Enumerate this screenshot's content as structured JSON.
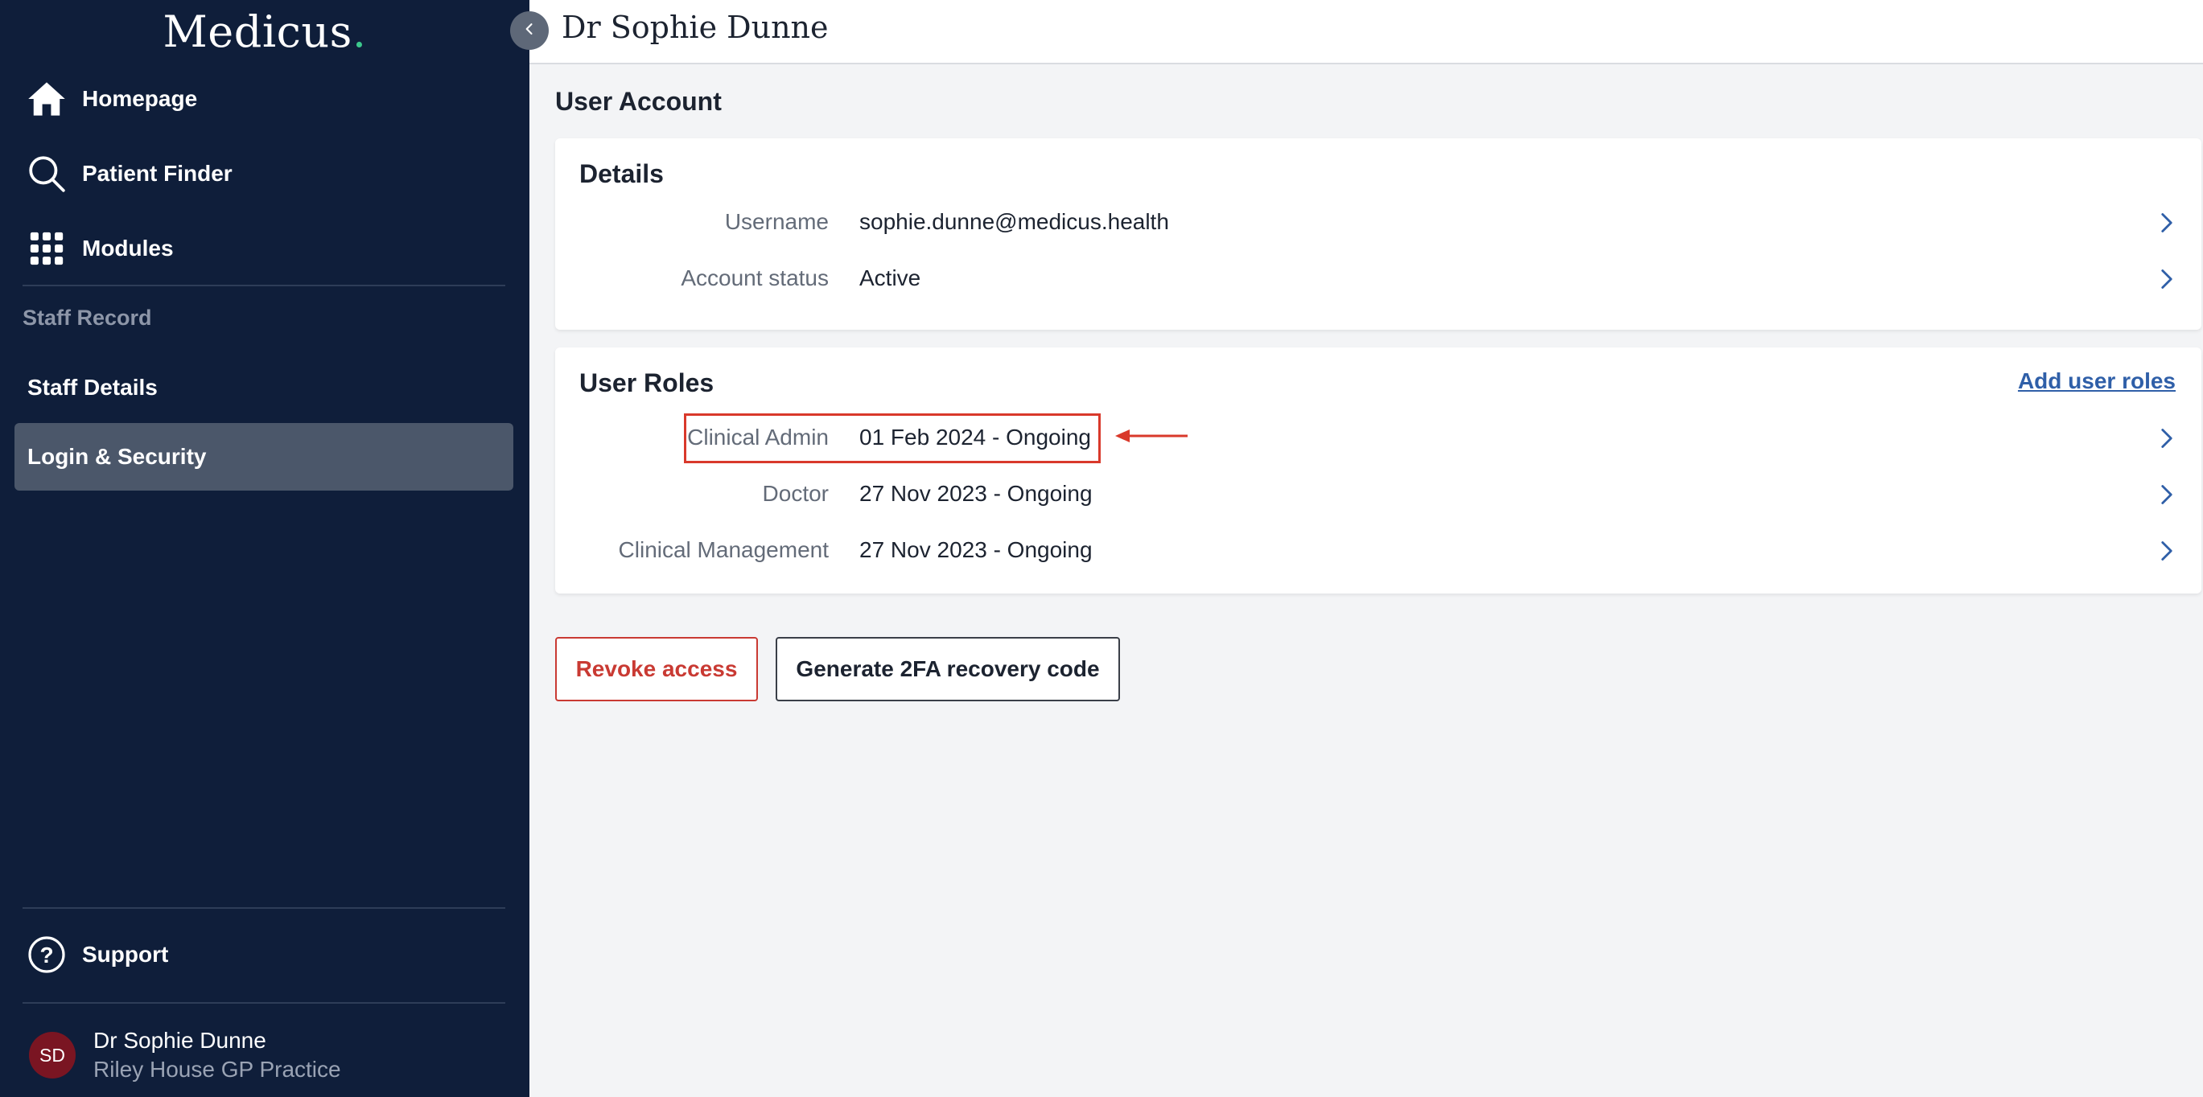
{
  "app": {
    "logo_text": "Medicus",
    "logo_dot": ".",
    "accent_color": "#3cc88c",
    "sidebar_bg": "#0f1e3a"
  },
  "sidebar": {
    "nav": [
      {
        "label": "Homepage",
        "icon": "home-icon"
      },
      {
        "label": "Patient Finder",
        "icon": "search-icon"
      },
      {
        "label": "Modules",
        "icon": "grid-icon"
      }
    ],
    "section_label": "Staff Record",
    "sub_items": [
      {
        "label": "Staff Details",
        "active": false
      },
      {
        "label": "Login & Security",
        "active": true
      }
    ],
    "support_label": "Support",
    "user": {
      "initials": "SD",
      "name": "Dr Sophie Dunne",
      "practice": "Riley House GP Practice"
    }
  },
  "header": {
    "title": "Dr Sophie Dunne"
  },
  "main": {
    "heading": "User Account",
    "details": {
      "title": "Details",
      "rows": [
        {
          "label": "Username",
          "value": "sophie.dunne@medicus.health"
        },
        {
          "label": "Account status",
          "value": "Active"
        }
      ]
    },
    "roles": {
      "title": "User Roles",
      "add_link": "Add user roles",
      "rows": [
        {
          "label": "Clinical Admin",
          "value": "01 Feb 2024 - Ongoing",
          "highlighted": true
        },
        {
          "label": "Doctor",
          "value": "27 Nov 2023 - Ongoing",
          "highlighted": false
        },
        {
          "label": "Clinical Management",
          "value": "27 Nov 2023 - Ongoing",
          "highlighted": false
        }
      ]
    },
    "actions": {
      "revoke_label": "Revoke access",
      "recovery_label": "Generate 2FA recovery code"
    }
  },
  "colors": {
    "danger": "#c93a33",
    "link": "#2f5fa8",
    "annotation": "#d9392b"
  }
}
